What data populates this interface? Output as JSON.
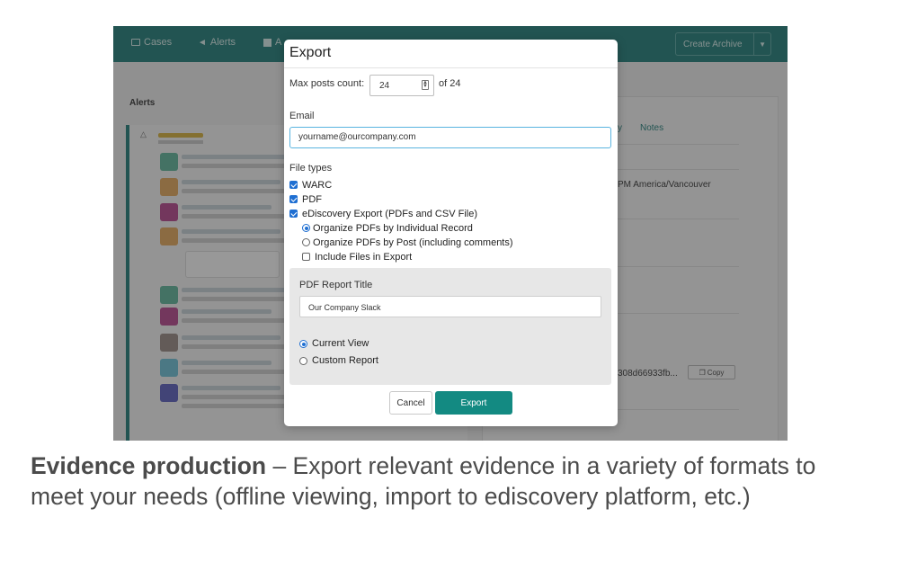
{
  "nav": {
    "items": [
      {
        "label": "Cases",
        "icon": "folder-icon"
      },
      {
        "label": "Alerts",
        "icon": "megaphone-icon"
      },
      {
        "label": "A",
        "icon": "calendar-icon"
      }
    ],
    "create_archive": "Create Archive"
  },
  "alerts": {
    "title": "Alerts"
  },
  "right_panel": {
    "tab_notes": "Notes",
    "tab_partial": "y",
    "timezone": "PM America/Vancouver",
    "hash": "308d66933fb...",
    "copy": "Copy"
  },
  "modal": {
    "title": "Export",
    "max_posts_label": "Max posts count:",
    "max_posts_value": "24",
    "of_total": "of 24",
    "email_label": "Email",
    "email_value": "yourname@ourcompany.com",
    "file_types_label": "File types",
    "file_types": [
      "WARC",
      "PDF",
      "eDiscovery Export (PDFs and CSV File)"
    ],
    "organize_options": [
      "Organize PDFs by Individual Record",
      "Organize PDFs by Post (including comments)"
    ],
    "include_files": "Include Files in Export",
    "report_title_label": "PDF Report Title",
    "report_title_value": "Our Company Slack",
    "view_options": [
      "Current View",
      "Custom Report"
    ],
    "cancel": "Cancel",
    "export": "Export"
  },
  "caption": {
    "bold": "Evidence production",
    "text": " – Export relevant evidence in a variety of formats to meet your needs (offline viewing, import to ediscovery platform, etc.)"
  },
  "colors": {
    "topbar": "#1e7e79",
    "export_button": "#138a82",
    "checkbox": "#1f6fd2"
  }
}
